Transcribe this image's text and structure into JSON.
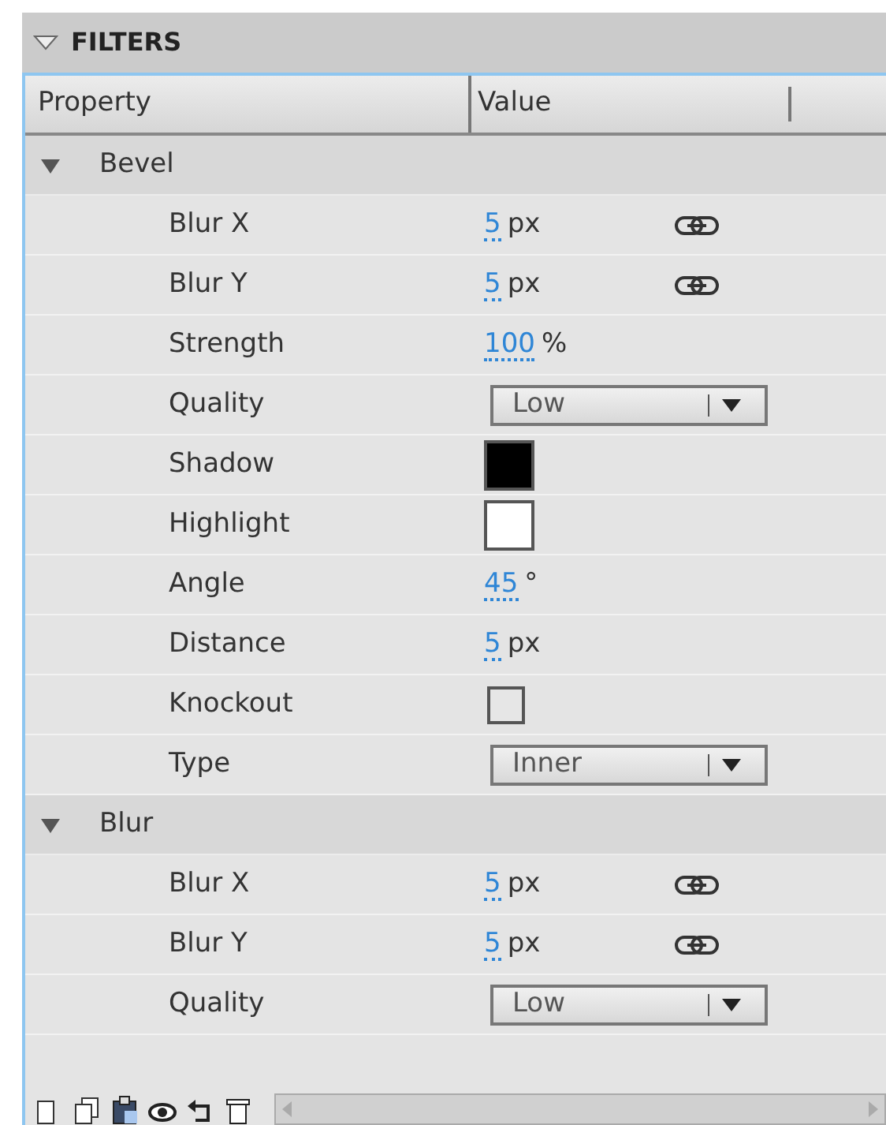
{
  "panel": {
    "title": "FILTERS",
    "expanded": true
  },
  "columns": [
    "Property",
    "Value"
  ],
  "groups": [
    {
      "name": "Bevel",
      "expanded": true,
      "rows": [
        {
          "kind": "number",
          "label": "Blur X",
          "value": "5",
          "unit": "px",
          "linked": true
        },
        {
          "kind": "number",
          "label": "Blur Y",
          "value": "5",
          "unit": "px",
          "linked": true
        },
        {
          "kind": "number",
          "label": "Strength",
          "value": "100",
          "unit": "%",
          "linked": false
        },
        {
          "kind": "dropdown",
          "label": "Quality",
          "value": "Low"
        },
        {
          "kind": "swatch",
          "label": "Shadow",
          "color": "#000000"
        },
        {
          "kind": "swatch",
          "label": "Highlight",
          "color": "#ffffff"
        },
        {
          "kind": "number",
          "label": "Angle",
          "value": "45",
          "unit": "°",
          "linked": false
        },
        {
          "kind": "number",
          "label": "Distance",
          "value": "5",
          "unit": "px",
          "linked": false
        },
        {
          "kind": "checkbox",
          "label": "Knockout",
          "checked": false
        },
        {
          "kind": "dropdown",
          "label": "Type",
          "value": "Inner"
        }
      ]
    },
    {
      "name": "Blur",
      "expanded": true,
      "rows": [
        {
          "kind": "number",
          "label": "Blur X",
          "value": "5",
          "unit": "px",
          "linked": true
        },
        {
          "kind": "number",
          "label": "Blur Y",
          "value": "5",
          "unit": "px",
          "linked": true
        },
        {
          "kind": "dropdown",
          "label": "Quality",
          "value": "Low"
        }
      ]
    }
  ]
}
